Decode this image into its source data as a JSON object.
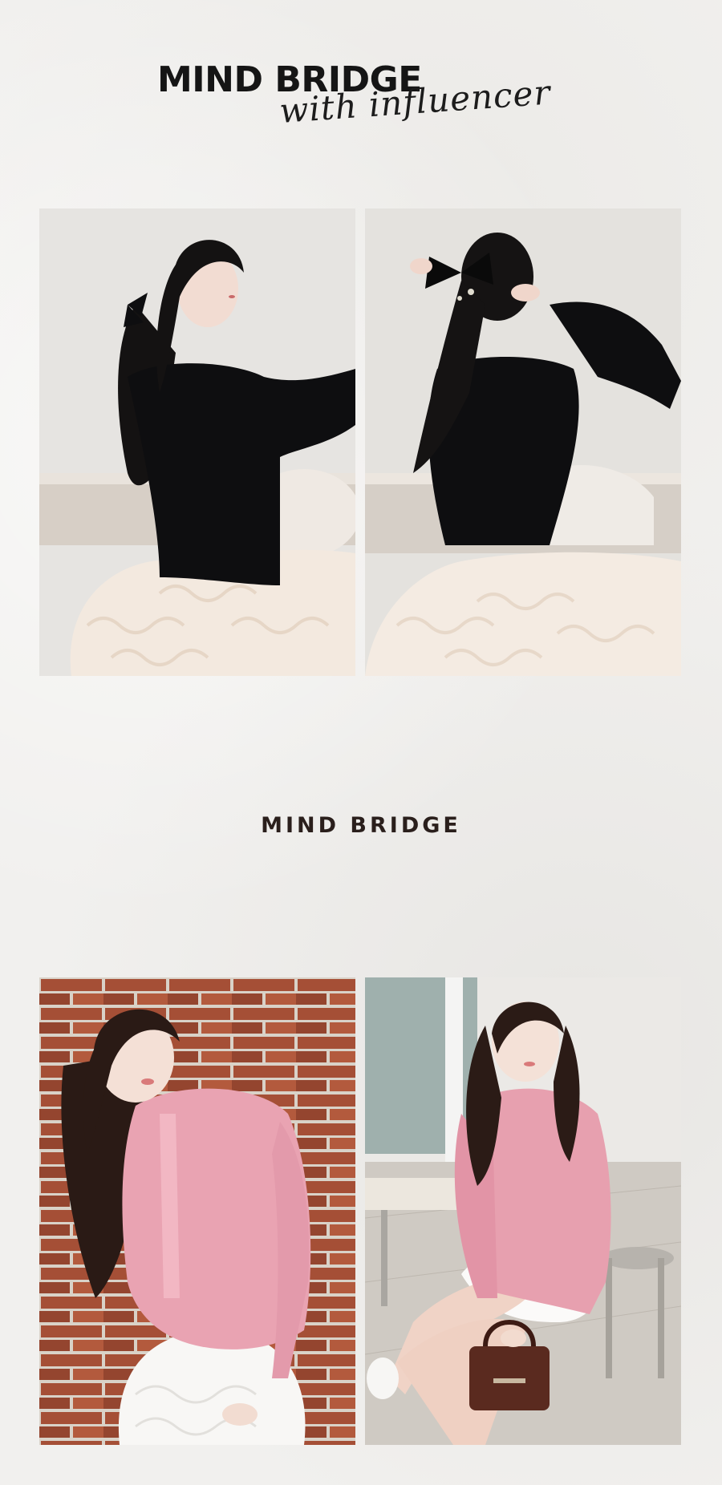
{
  "header": {
    "brand": "MIND BRIDGE",
    "tagline": "with influencer"
  },
  "section_label": "MIND BRIDGE",
  "photos": [
    {
      "icon": "photo-black-top-side-pose"
    },
    {
      "icon": "photo-black-top-back-pose"
    },
    {
      "icon": "photo-pink-cardigan-brick-wall"
    },
    {
      "icon": "photo-pink-cardigan-seated"
    }
  ],
  "colors": {
    "background": "#f1f0ee",
    "text": "#151515",
    "black_top": "#0e0e10",
    "tulle_skirt": "#f3e9df",
    "pink_cardigan": "#e9a3b2",
    "brick": "#9a4a34"
  }
}
